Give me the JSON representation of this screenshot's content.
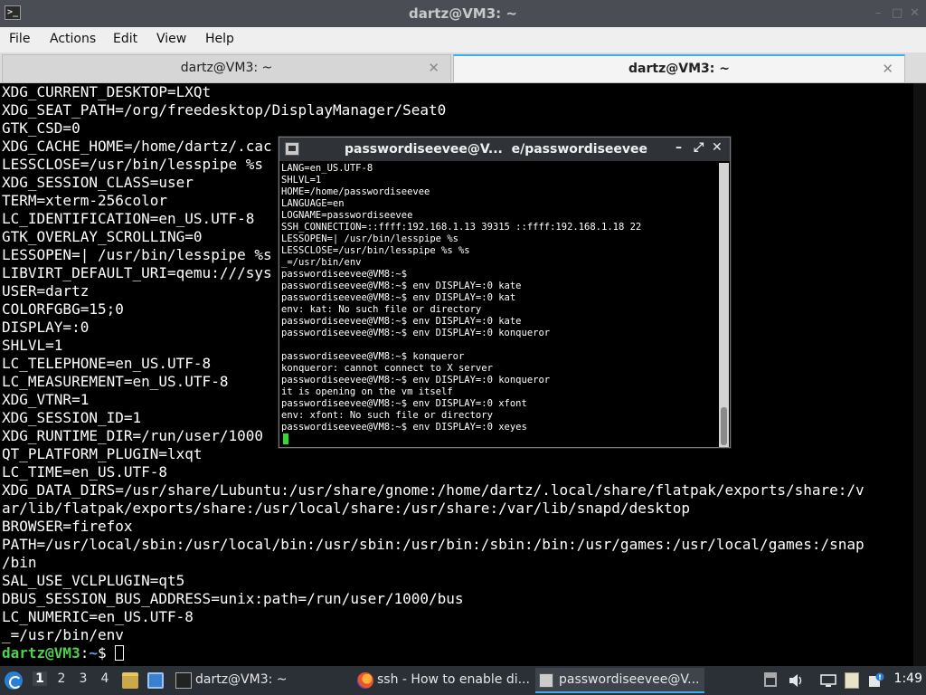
{
  "window": {
    "title": "dartz@VM3: ~",
    "icon": "terminal-icon",
    "controls": [
      "–",
      "□",
      "✕"
    ]
  },
  "menubar": [
    "File",
    "Actions",
    "Edit",
    "View",
    "Help"
  ],
  "tabs": [
    {
      "label": "dartz@VM3: ~",
      "close": "✕",
      "active": false
    },
    {
      "label": "dartz@VM3: ~",
      "close": "✕",
      "active": true
    }
  ],
  "terminal": {
    "lines": [
      "XDG_CURRENT_DESKTOP=LXQt",
      "XDG_SEAT_PATH=/org/freedesktop/DisplayManager/Seat0",
      "GTK_CSD=0",
      "XDG_CACHE_HOME=/home/dartz/.cac",
      "LESSCLOSE=/usr/bin/lesspipe %s",
      "XDG_SESSION_CLASS=user",
      "TERM=xterm-256color",
      "LC_IDENTIFICATION=en_US.UTF-8",
      "GTK_OVERLAY_SCROLLING=0",
      "LESSOPEN=| /usr/bin/lesspipe %s",
      "LIBVIRT_DEFAULT_URI=qemu:///sys",
      "USER=dartz",
      "COLORFGBG=15;0",
      "DISPLAY=:0",
      "SHLVL=1",
      "LC_TELEPHONE=en_US.UTF-8",
      "LC_MEASUREMENT=en_US.UTF-8",
      "XDG_VTNR=1",
      "XDG_SESSION_ID=1",
      "XDG_RUNTIME_DIR=/run/user/1000",
      "QT_PLATFORM_PLUGIN=lxqt",
      "LC_TIME=en_US.UTF-8",
      "XDG_DATA_DIRS=/usr/share/Lubuntu:/usr/share/gnome:/home/dartz/.local/share/flatpak/exports/share:/v",
      "ar/lib/flatpak/exports/share:/usr/local/share:/usr/share:/var/lib/snapd/desktop",
      "BROWSER=firefox",
      "PATH=/usr/local/sbin:/usr/local/bin:/usr/sbin:/usr/bin:/sbin:/bin:/usr/games:/usr/local/games:/snap",
      "/bin",
      "SAL_USE_VCLPLUGIN=qt5",
      "DBUS_SESSION_BUS_ADDRESS=unix:path=/run/user/1000/bus",
      "LC_NUMERIC=en_US.UTF-8",
      "_=/usr/bin/env"
    ],
    "prompt": {
      "user": "dartz@VM3",
      "sep": ":",
      "path": "~",
      "symbol": "$ "
    }
  },
  "xterm": {
    "title": "passwordiseevee@V...  e/passwordiseevee",
    "buttons": [
      "–",
      "⤢",
      "✕"
    ],
    "lines": [
      "LANG=en_US.UTF-8",
      "SHLVL=1",
      "HOME=/home/passwordiseevee",
      "LANGUAGE=en",
      "LOGNAME=passwordiseevee",
      "SSH_CONNECTION=::ffff:192.168.1.13 39315 ::ffff:192.168.1.18 22",
      "LESSOPEN=| /usr/bin/lesspipe %s",
      "LESSCLOSE=/usr/bin/lesspipe %s %s",
      "_=/usr/bin/env",
      "passwordiseevee@VM8:~$",
      "passwordiseevee@VM8:~$ env DISPLAY=:0 kate",
      "passwordiseevee@VM8:~$ env DISPLAY=:0 kat",
      "env: kat: No such file or directory",
      "passwordiseevee@VM8:~$ env DISPLAY=:0 kate",
      "passwordiseevee@VM8:~$ env DISPLAY=:0 konqueror",
      "",
      "passwordiseevee@VM8:~$ konqueror",
      "konqueror: cannot connect to X server",
      "passwordiseevee@VM8:~$ env DISPLAY=:0 konqueror",
      "it is opening on the vm itself",
      "passwordiseevee@VM8:~$ env DISPLAY=:0 xfont",
      "env: xfont: No such file or directory",
      "passwordiseevee@VM8:~$ env DISPLAY=:0 xeyes"
    ]
  },
  "taskbar": {
    "start_icon": "lubuntu-menu-icon",
    "workspaces": [
      "1",
      "2",
      "3",
      "4"
    ],
    "quicklaunch": [
      "file-manager-icon",
      "show-desktop-icon"
    ],
    "tasks": [
      {
        "icon": "terminal-icon",
        "label": "dartz@VM3: ~",
        "active": false
      },
      {
        "icon": "firefox-icon",
        "label": "ssh - How to enable di...",
        "active": false
      },
      {
        "icon": "xterm-icon",
        "label": "passwordiseevee@V...",
        "active": true
      }
    ],
    "tray": [
      "eject-icon",
      "volume-icon",
      "network-icon",
      "clipboard-icon",
      "update-notifier-icon"
    ],
    "clock": "1:49"
  }
}
